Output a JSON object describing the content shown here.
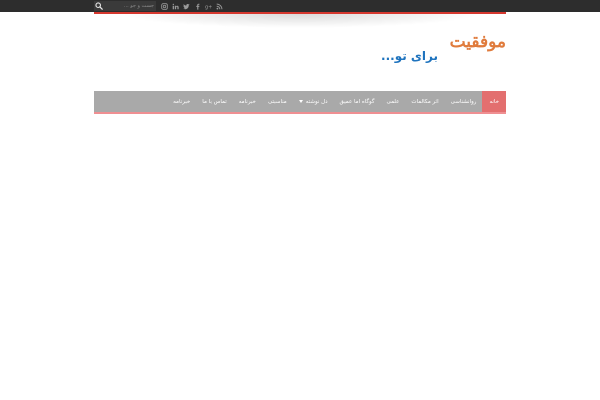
{
  "top_bar": {
    "search": {
      "placeholder": "جست و جو ..."
    },
    "social_icons": [
      "instagram-icon",
      "linkedin-icon",
      "twitter-icon",
      "facebook-icon",
      "google-plus-icon",
      "rss-icon"
    ]
  },
  "logo": {
    "main_text": "موفقیت",
    "tagline": "برای تو..."
  },
  "nav": {
    "items": [
      {
        "label": "خانه",
        "active": true
      },
      {
        "label": "روانشناسی"
      },
      {
        "label": "اثر مکالمات"
      },
      {
        "label": "علمی"
      },
      {
        "label": "گوگاه اما عمیق"
      },
      {
        "label": "دل نوشته",
        "has_dropdown": true
      },
      {
        "label": "مناسبتی"
      },
      {
        "label": "خبرنامه"
      },
      {
        "label": "تماس با ما"
      },
      {
        "label": "خبرنامه"
      }
    ]
  },
  "colors": {
    "top_bar": "#2d2d2d",
    "accent_red": "#d5382f",
    "nav_bg": "#a9a9a9",
    "nav_active": "#e36f6f",
    "logo_orange": "#e07b3c",
    "logo_blue": "#1e73be"
  }
}
